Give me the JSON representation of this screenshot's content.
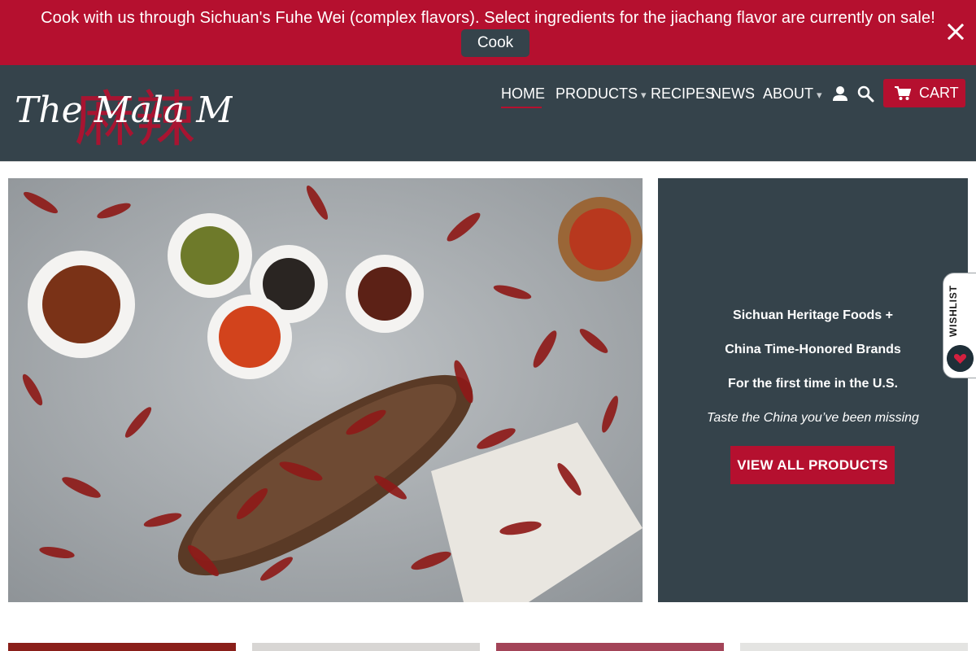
{
  "announcement": {
    "text": "Cook with us through Sichuan's Fuhe Wei (complex flavors). Select ingredients for the jiachang flavor are currently on sale!",
    "button_label": "Cook",
    "close_icon": "close-icon"
  },
  "brand": {
    "logo_text": "The Mala Market",
    "logo_glyphs": "麻辣"
  },
  "nav": {
    "items": [
      {
        "label": "HOME",
        "active": true
      },
      {
        "label": "PRODUCTS",
        "caret": "▾"
      },
      {
        "label": "RECIPES"
      },
      {
        "label": "NEWS"
      },
      {
        "label": "ABOUT",
        "caret": "▾"
      }
    ],
    "account_icon": "user-icon",
    "search_icon": "search-icon",
    "cart_label": "CART",
    "cart_icon": "cart-icon"
  },
  "hero": {
    "image_alt": "dried chili peppers with bowls of spices",
    "promo": {
      "line1": "Sichuan Heritage Foods +",
      "line2": "China Time-Honored Brands",
      "line3": "For the first time in the U.S.",
      "tagline": "Taste the China you’ve been missing",
      "button_label": "VIEW ALL PRODUCTS"
    }
  },
  "wishlist": {
    "label": "WISHLIST",
    "icon": "heart-icon"
  },
  "colors": {
    "brand_red": "#b5102f",
    "header_slate": "#35434b",
    "white": "#ffffff"
  }
}
